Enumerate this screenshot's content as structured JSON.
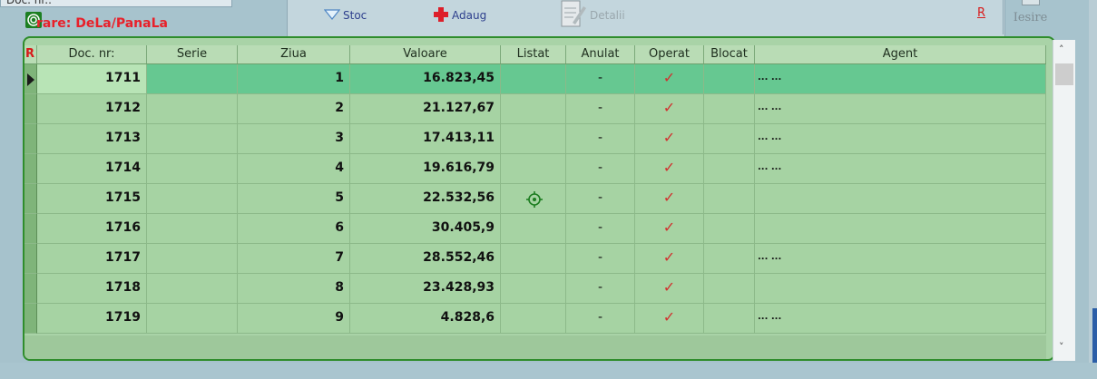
{
  "top": {
    "docnr_field_label": "Doc. nr.:",
    "filter_label": "rare: DeLa/PanaLa"
  },
  "toolbar": {
    "stoc": "Stoc",
    "adaug": "Adaug",
    "detalii": "Detalii",
    "r": "R",
    "iesire": "Iesire"
  },
  "grid": {
    "row_indicator_header": "R",
    "columns": [
      "Doc. nr:",
      "Serie",
      "Ziua",
      "Valoare",
      "Listat",
      "Anulat",
      "Operat",
      "Blocat",
      "Agent"
    ],
    "rows": [
      {
        "docnr": "1711",
        "serie": "",
        "ziua": "1",
        "valoare": "16.823,45",
        "listat": "",
        "anulat": "-",
        "operat": "✓",
        "blocat": "",
        "agent": "... ..."
      },
      {
        "docnr": "1712",
        "serie": "",
        "ziua": "2",
        "valoare": "21.127,67",
        "listat": "",
        "anulat": "-",
        "operat": "✓",
        "blocat": "",
        "agent": "... ..."
      },
      {
        "docnr": "1713",
        "serie": "",
        "ziua": "3",
        "valoare": "17.413,11",
        "listat": "",
        "anulat": "-",
        "operat": "✓",
        "blocat": "",
        "agent": "... ..."
      },
      {
        "docnr": "1714",
        "serie": "",
        "ziua": "4",
        "valoare": "19.616,79",
        "listat": "",
        "anulat": "-",
        "operat": "✓",
        "blocat": "",
        "agent": "... ..."
      },
      {
        "docnr": "1715",
        "serie": "",
        "ziua": "5",
        "valoare": "22.532,56",
        "listat": "",
        "anulat": "-",
        "operat": "✓",
        "blocat": "",
        "agent": ""
      },
      {
        "docnr": "1716",
        "serie": "",
        "ziua": "6",
        "valoare": "30.405,9",
        "listat": "",
        "anulat": "-",
        "operat": "✓",
        "blocat": "",
        "agent": ""
      },
      {
        "docnr": "1717",
        "serie": "",
        "ziua": "7",
        "valoare": "28.552,46",
        "listat": "",
        "anulat": "-",
        "operat": "✓",
        "blocat": "",
        "agent": "... ..."
      },
      {
        "docnr": "1718",
        "serie": "",
        "ziua": "8",
        "valoare": "23.428,93",
        "listat": "",
        "anulat": "-",
        "operat": "✓",
        "blocat": "",
        "agent": ""
      },
      {
        "docnr": "1719",
        "serie": "",
        "ziua": "9",
        "valoare": "4.828,6",
        "listat": "",
        "anulat": "-",
        "operat": "✓",
        "blocat": "",
        "agent": "... ..."
      }
    ]
  },
  "icons": {
    "filter": "target-icon",
    "stoc": "triangle-down-icon",
    "adaug": "plus-icon",
    "detalii": "document-edit-icon",
    "listat_marker": "crosshair-icon",
    "row_pointer": "row-pointer-icon"
  },
  "colors": {
    "grid_bg": "#a6d3a3",
    "selected_row": "#66c891",
    "grid_border": "#2f8d2c",
    "accent_red": "#e8202a"
  }
}
